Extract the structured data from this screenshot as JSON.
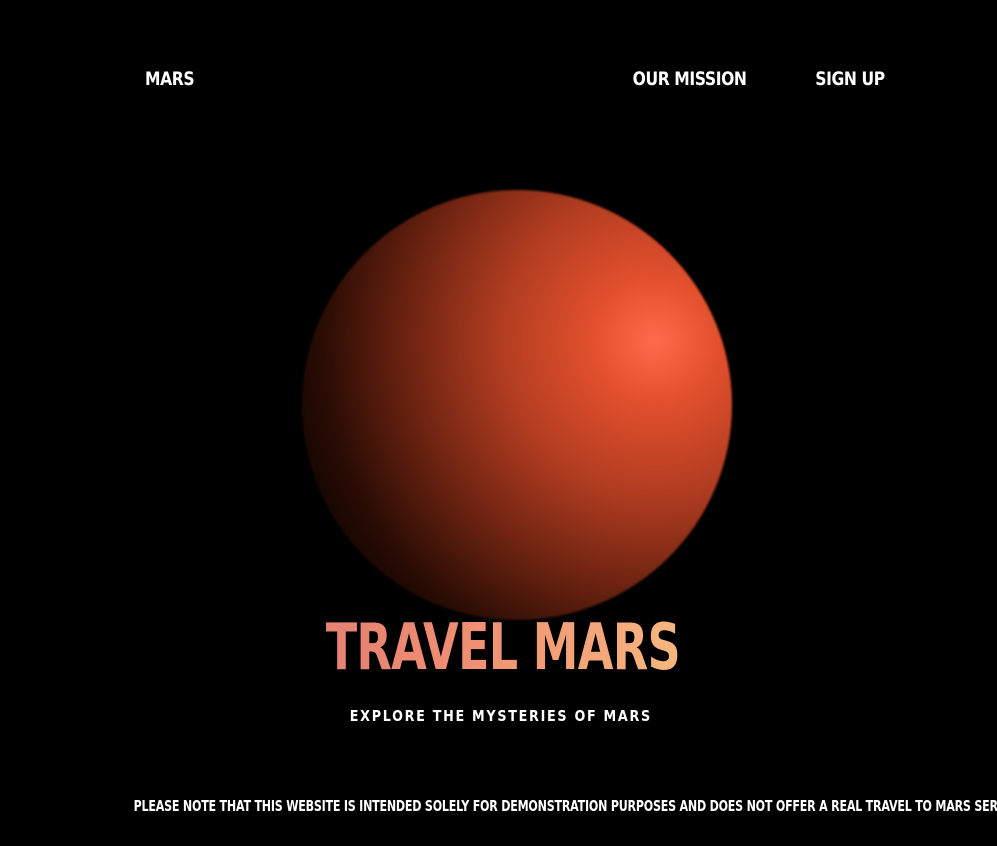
{
  "nav": {
    "logo": "MARS",
    "mission_label": "OUR MISSION",
    "signup_label": "SIGN UP"
  },
  "hero": {
    "title": "TRAVEL MARS",
    "subtitle": "EXPLORE THE MYSTERIES OF MARS"
  },
  "footer": {
    "disclaimer": "PLEASE NOTE THAT THIS WEBSITE IS INTENDED SOLELY FOR DEMONSTRATION PURPOSES AND DOES NOT OFFER A REAL TRAVEL TO MARS SERVICE."
  },
  "colors": {
    "background": "#000000",
    "planet_highlight": "#ff6b4a",
    "title_gradient_start": "#d96f72",
    "title_gradient_end": "#ffd98a"
  }
}
